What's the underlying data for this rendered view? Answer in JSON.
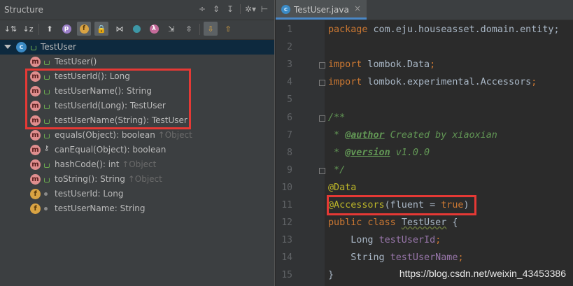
{
  "structure": {
    "title": "Structure",
    "header_icons": [
      "expand-all-icon",
      "collapse-all-icon",
      "settings-icon",
      "hide-icon"
    ],
    "toolbar_icons": [
      "sort-by-visibility-icon",
      "sort-alphabetically-icon",
      "show-inherited-icon",
      "show-properties-icon",
      "show-fields-icon",
      "show-non-public-icon",
      "show-lambdas-icon",
      "show-anonymous-icon",
      "show-lambda-icon",
      "expand-icon",
      "collapse-icon",
      "autoscroll-to-source-icon",
      "autoscroll-from-source-icon"
    ],
    "root": {
      "label": "TestUser",
      "kind": "c"
    },
    "items": [
      {
        "kind": "m",
        "vis": "lock-open",
        "label": "TestUser()",
        "suffix": ""
      },
      {
        "kind": "m",
        "vis": "lock-open",
        "label": "testUserId(): Long",
        "suffix": ""
      },
      {
        "kind": "m",
        "vis": "lock-open",
        "label": "testUserName(): String",
        "suffix": ""
      },
      {
        "kind": "m",
        "vis": "lock-open",
        "label": "testUserId(Long): TestUser",
        "suffix": ""
      },
      {
        "kind": "m",
        "vis": "lock-open",
        "label": "testUserName(String): TestUser",
        "suffix": ""
      },
      {
        "kind": "m",
        "vis": "lock-open",
        "label": "equals(Object): boolean ",
        "suffix": "↑Object"
      },
      {
        "kind": "m",
        "vis": "key",
        "label": "canEqual(Object): boolean",
        "suffix": ""
      },
      {
        "kind": "m",
        "vis": "lock-open",
        "label": "hashCode(): int ",
        "suffix": "↑Object"
      },
      {
        "kind": "m",
        "vis": "lock-open",
        "label": "toString(): String ",
        "suffix": "↑Object"
      },
      {
        "kind": "f",
        "vis": "dot",
        "label": "testUserId: Long",
        "suffix": ""
      },
      {
        "kind": "f",
        "vis": "dot",
        "label": "testUserName: String",
        "suffix": ""
      }
    ]
  },
  "editor": {
    "tab": {
      "label": "TestUser.java",
      "kind": "c",
      "close": "×"
    },
    "lines": [
      {
        "n": "1",
        "tokens": [
          [
            "kw",
            "package"
          ],
          [
            "t",
            " com.eju.houseasset.domain.entity;"
          ]
        ]
      },
      {
        "n": "2",
        "tokens": []
      },
      {
        "n": "3",
        "tokens": [
          [
            "kw",
            "import"
          ],
          [
            "t",
            " lombok."
          ],
          [
            "t",
            "Data"
          ],
          [
            "kw",
            ";"
          ]
        ]
      },
      {
        "n": "4",
        "tokens": [
          [
            "kw",
            "import"
          ],
          [
            "t",
            " lombok.experimental."
          ],
          [
            "t",
            "Accessors"
          ],
          [
            "kw",
            ";"
          ]
        ]
      },
      {
        "n": "5",
        "tokens": []
      },
      {
        "n": "6",
        "tokens": [
          [
            "doc",
            "/**"
          ]
        ]
      },
      {
        "n": "7",
        "tokens": [
          [
            "doc",
            " * "
          ],
          [
            "doctag",
            "@author"
          ],
          [
            "doc",
            " Created by xiaoxian"
          ]
        ]
      },
      {
        "n": "8",
        "tokens": [
          [
            "doc",
            " * "
          ],
          [
            "doctag",
            "@version"
          ],
          [
            "doc",
            " v1.0.0"
          ]
        ]
      },
      {
        "n": "9",
        "tokens": [
          [
            "doc",
            " */"
          ]
        ]
      },
      {
        "n": "10",
        "tokens": [
          [
            "ann",
            "@Data"
          ]
        ]
      },
      {
        "n": "11",
        "tokens": [
          [
            "ann",
            "@Accessors"
          ],
          [
            "t",
            "(fluent = "
          ],
          [
            "kw",
            "true"
          ],
          [
            "t",
            ")"
          ]
        ]
      },
      {
        "n": "12",
        "tokens": [
          [
            "kw",
            "public class "
          ],
          [
            "cls",
            "TestUser"
          ],
          [
            "t",
            " {"
          ]
        ]
      },
      {
        "n": "13",
        "tokens": [
          [
            "t",
            "    Long "
          ],
          [
            "fld",
            "testUserId"
          ],
          [
            "kw",
            ";"
          ]
        ]
      },
      {
        "n": "14",
        "tokens": [
          [
            "t",
            "    String "
          ],
          [
            "fld",
            "testUserName"
          ],
          [
            "kw",
            ";"
          ]
        ]
      },
      {
        "n": "15",
        "tokens": [
          [
            "t",
            "}"
          ]
        ]
      }
    ],
    "watermark": "https://blog.csdn.net/weixin_43453386"
  },
  "colors": {
    "highlight_box": "#e53935",
    "selection": "#0d293e",
    "tab_accent": "#4a88c7"
  }
}
